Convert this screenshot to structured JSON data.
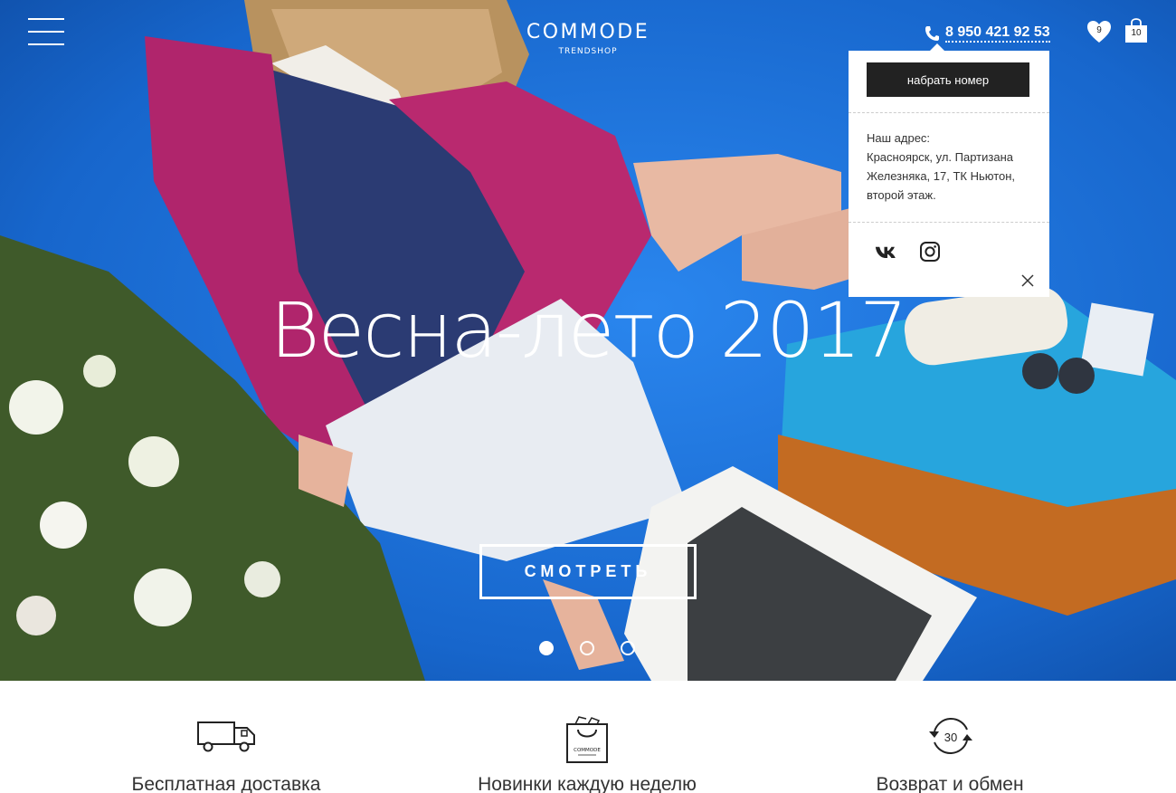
{
  "header": {
    "logo_main": "COMMODE",
    "logo_sub": "TRENDSHOP",
    "phone": "8 950 421 92 53",
    "wishlist_count": "9",
    "cart_count": "10"
  },
  "hero": {
    "headline": "Весна-лето 2017",
    "cta_label": "СМОТРЕТЬ",
    "slides": 3,
    "active_slide": 1
  },
  "popup": {
    "call_button": "набрать номер",
    "address_label": "Наш адрес:",
    "address_text": "Красноярск, ул. Партизана Железняка, 17, ТК Ньютон, второй этаж."
  },
  "features": [
    {
      "label": "Бесплатная доставка",
      "icon": "truck-icon"
    },
    {
      "label": "Новинки каждую неделю",
      "icon": "shopping-bag-icon",
      "icon_text": "COMMODE"
    },
    {
      "label": "Возврат и обмен",
      "icon": "return-30-icon",
      "icon_text": "30"
    }
  ],
  "colors": {
    "hero_blue": "#1d6fd8",
    "dark_button": "#222222",
    "white": "#ffffff"
  }
}
